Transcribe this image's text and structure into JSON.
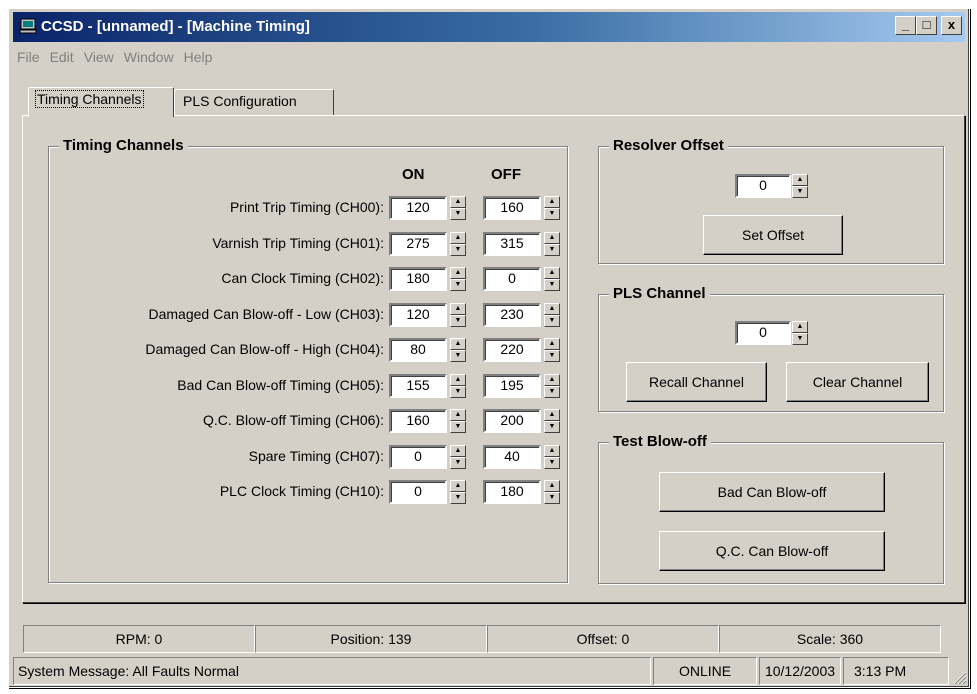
{
  "window": {
    "title": "CCSD - [unnamed] - [Machine Timing]",
    "controls": {
      "minimize": "_",
      "restore": "□",
      "close": "x"
    }
  },
  "menu": [
    "File",
    "Edit",
    "View",
    "Window",
    "Help"
  ],
  "tabs": [
    {
      "label": "Timing Channels",
      "active": true
    },
    {
      "label": "PLS Configuration",
      "active": false
    }
  ],
  "timing": {
    "group_title": "Timing Channels",
    "on_header": "ON",
    "off_header": "OFF",
    "rows": [
      {
        "label": "Print Trip Timing (CH00):",
        "on": "120",
        "off": "160"
      },
      {
        "label": "Varnish Trip Timing (CH01):",
        "on": "275",
        "off": "315"
      },
      {
        "label": "Can Clock Timing (CH02):",
        "on": "180",
        "off": "0"
      },
      {
        "label": "Damaged Can Blow-off - Low (CH03):",
        "on": "120",
        "off": "230"
      },
      {
        "label": "Damaged Can Blow-off - High (CH04):",
        "on": "80",
        "off": "220"
      },
      {
        "label": "Bad Can Blow-off Timing (CH05):",
        "on": "155",
        "off": "195"
      },
      {
        "label": "Q.C. Blow-off Timing (CH06):",
        "on": "160",
        "off": "200"
      },
      {
        "label": "Spare Timing (CH07):",
        "on": "0",
        "off": "40"
      },
      {
        "label": "PLC Clock Timing (CH10):",
        "on": "0",
        "off": "180"
      }
    ]
  },
  "resolver": {
    "group_title": "Resolver Offset",
    "value": "0",
    "set_button": "Set Offset"
  },
  "pls_channel": {
    "group_title": "PLS Channel",
    "value": "0",
    "recall_button": "Recall Channel",
    "clear_button": "Clear Channel"
  },
  "test_blowoff": {
    "group_title": "Test Blow-off",
    "bad_can_button": "Bad Can Blow-off",
    "qc_can_button": "Q.C. Can Blow-off"
  },
  "status_top": {
    "rpm": "RPM: 0",
    "position": "Position: 139",
    "offset": "Offset: 0",
    "scale": "Scale: 360"
  },
  "status_bottom": {
    "message": "System Message: All Faults Normal",
    "mode": "ONLINE",
    "date": "10/12/2003",
    "time": "3:13 PM"
  },
  "icons": {
    "app": "computer-icon",
    "spin_up": "arrow-up-icon",
    "spin_down": "arrow-down-icon",
    "grip": "resize-grip-icon"
  },
  "colors": {
    "face": "#d4d0c8",
    "title_start": "#0a246a",
    "title_end": "#a6caf0",
    "disabled_text": "#808080"
  }
}
